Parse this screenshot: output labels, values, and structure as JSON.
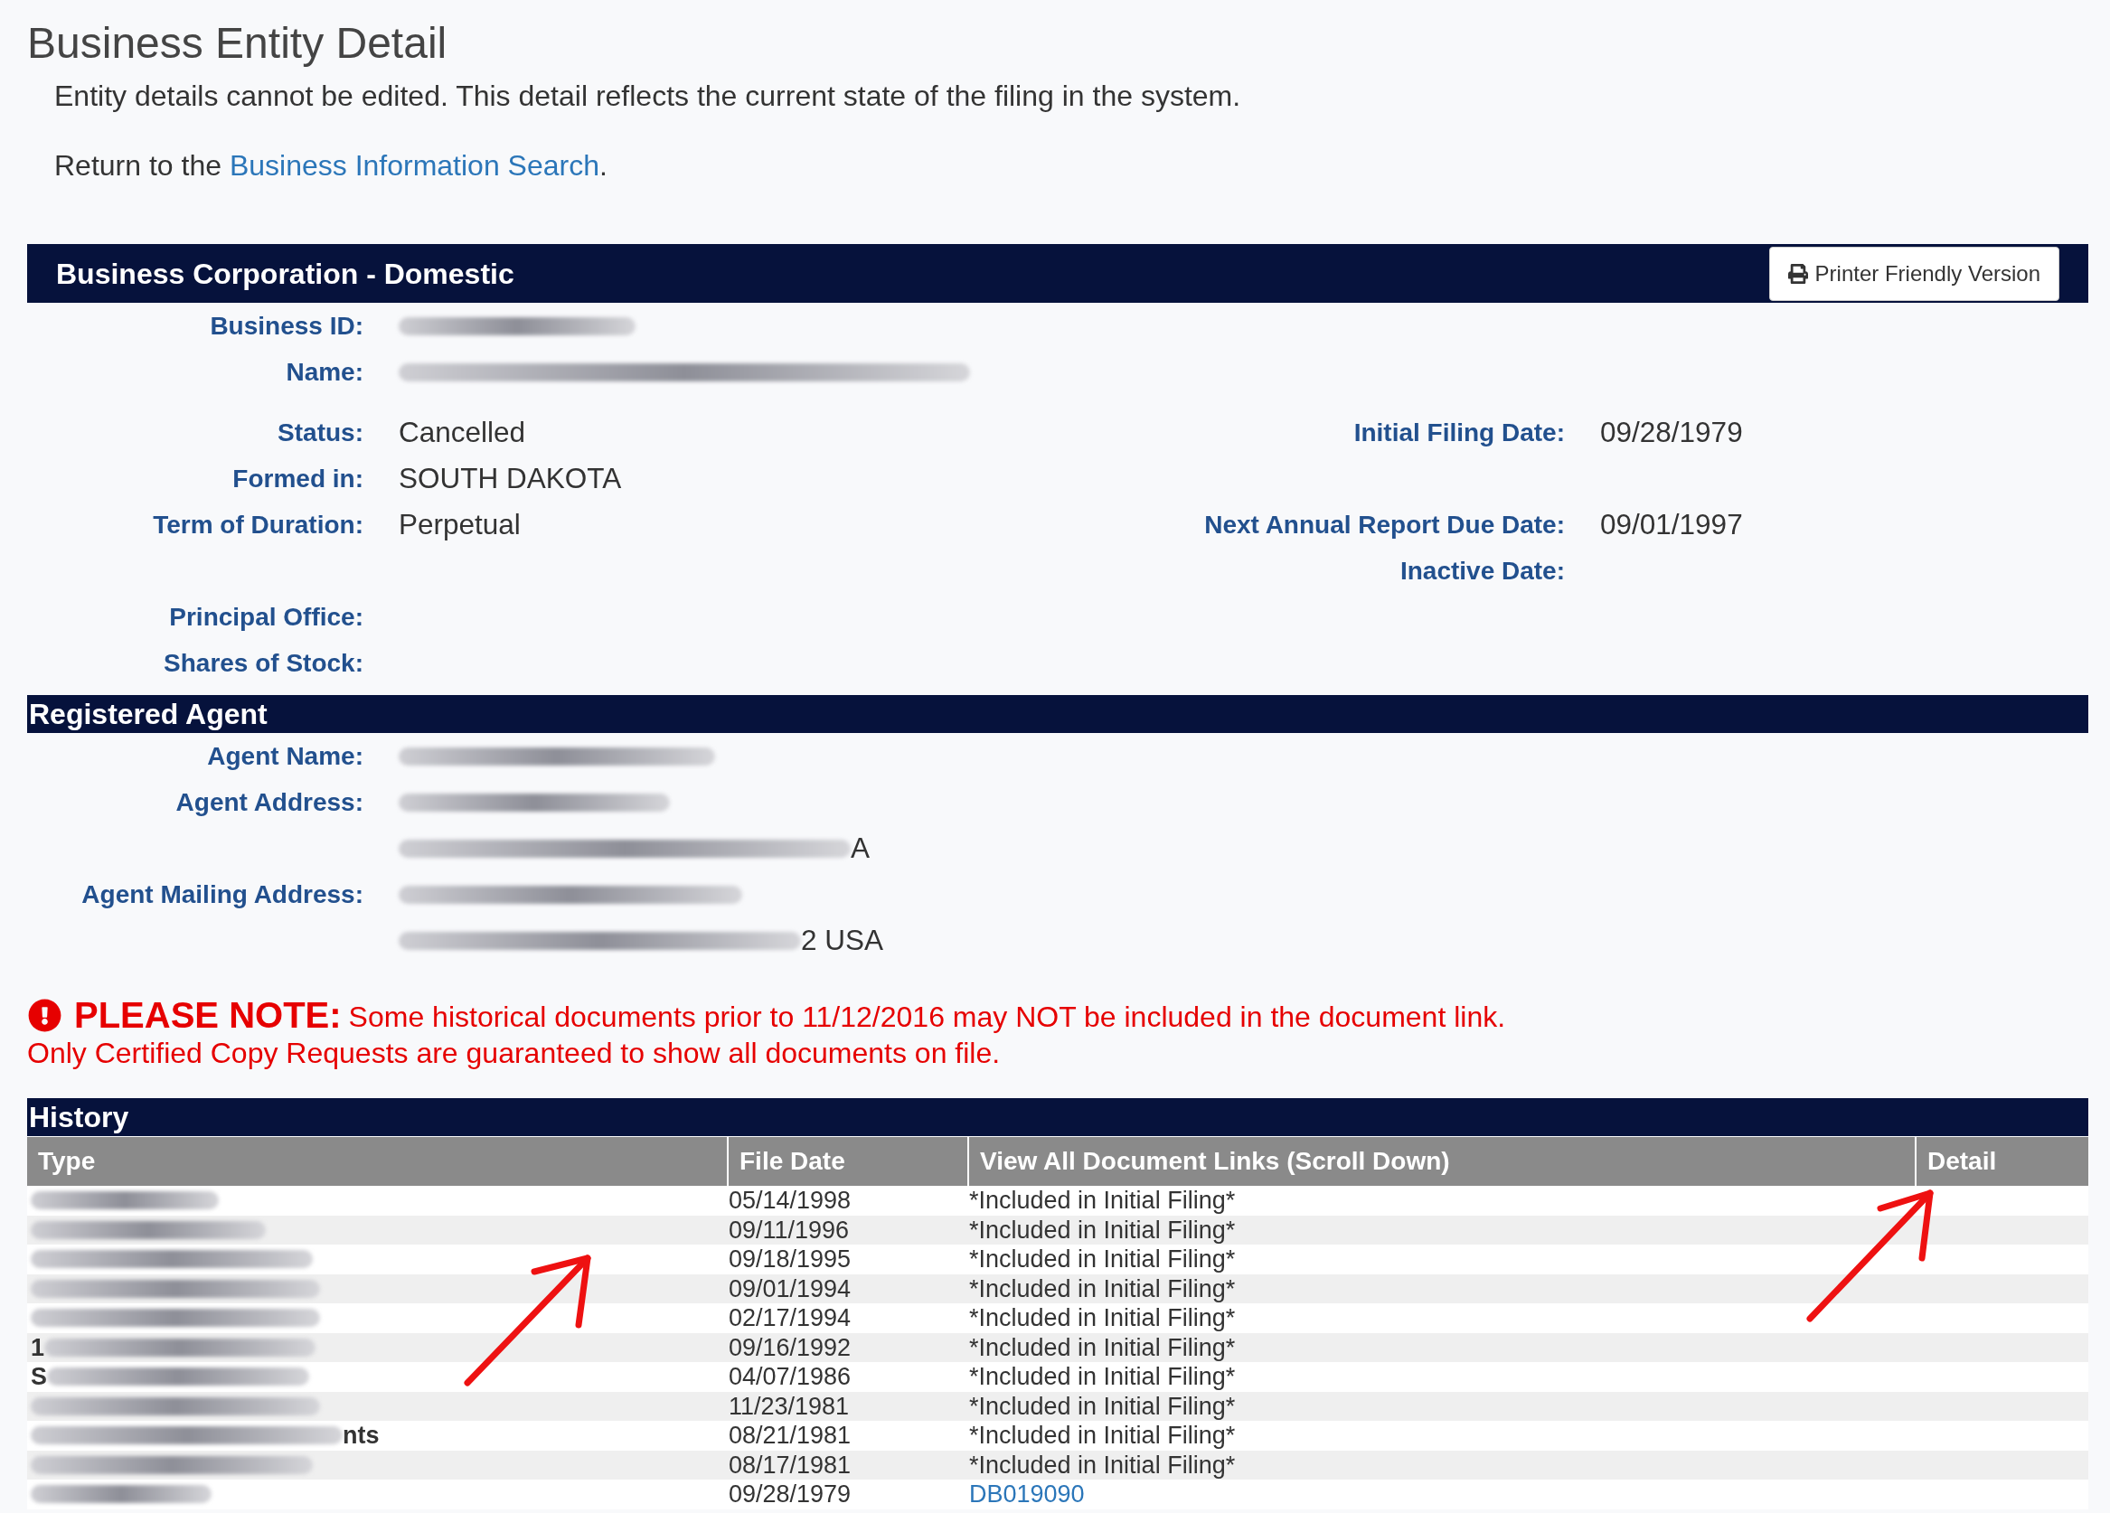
{
  "page_title": "Business Entity Detail",
  "intro": "Entity details cannot be edited. This detail reflects the current state of the filing in the system.",
  "return_line": {
    "before": "Return to the",
    "link": "Business Information Search",
    "after": "."
  },
  "entity": {
    "title": "Business Corporation - Domestic",
    "print_button": {
      "label": "Printer Friendly Version"
    },
    "groups": [
      {
        "rows": [
          {
            "left": {
              "label": "Business ID:",
              "value": {
                "kind": "redacted"
              }
            }
          },
          {
            "left": {
              "label": "Name:",
              "value": {
                "kind": "redacted"
              }
            }
          }
        ]
      },
      {
        "rows": [
          {
            "left": {
              "label": "Status:",
              "value": {
                "kind": "text",
                "text": "Cancelled"
              }
            },
            "right": {
              "label": "Initial Filing Date:",
              "value": {
                "kind": "text",
                "text": "09/28/1979"
              }
            }
          },
          {
            "left": {
              "label": "Formed in:",
              "value": {
                "kind": "text",
                "text": "SOUTH DAKOTA"
              }
            }
          },
          {
            "left": {
              "label": "Term of Duration:",
              "value": {
                "kind": "text",
                "text": "Perpetual"
              }
            },
            "right": {
              "label": "Next Annual Report Due Date:",
              "value": {
                "kind": "text",
                "text": "09/01/1997"
              }
            }
          },
          {
            "right": {
              "label": "Inactive Date:"
            }
          },
          {
            "left": {
              "label": "Principal Office:"
            }
          },
          {
            "left": {
              "label": "Shares of Stock:"
            }
          }
        ]
      }
    ]
  },
  "registered_agent": {
    "title": "Registered Agent",
    "fields": [
      {
        "label": "Agent Name:",
        "lines": [
          {
            "kind": "redacted"
          }
        ]
      },
      {
        "label": "Agent Address:",
        "lines": [
          {
            "kind": "redacted"
          },
          {
            "kind": "redacted",
            "tail": "A"
          }
        ]
      },
      {
        "label": "Agent Mailing Address:",
        "lines": [
          {
            "kind": "redacted"
          },
          {
            "kind": "redacted",
            "tail": "2 USA"
          }
        ]
      }
    ]
  },
  "notice": {
    "label": "PLEASE NOTE:",
    "text": "Some historical documents prior to 11/12/2016 may NOT be included in the document link.",
    "second_line": "Only Certified Copy Requests are guaranteed to show all documents on file."
  },
  "history": {
    "title": "History",
    "columns": [
      "Type",
      "File Date",
      "View All Document Links (Scroll Down)",
      "Detail"
    ],
    "rows": [
      {
        "type": {
          "kind": "redacted"
        },
        "file_date": "05/14/1998",
        "document": {
          "kind": "text",
          "text": "*Included in Initial Filing*"
        }
      },
      {
        "type": {
          "kind": "redacted"
        },
        "file_date": "09/11/1996",
        "document": {
          "kind": "text",
          "text": "*Included in Initial Filing*"
        }
      },
      {
        "type": {
          "kind": "redacted"
        },
        "file_date": "09/18/1995",
        "document": {
          "kind": "text",
          "text": "*Included in Initial Filing*"
        }
      },
      {
        "type": {
          "kind": "redacted"
        },
        "file_date": "09/01/1994",
        "document": {
          "kind": "text",
          "text": "*Included in Initial Filing*"
        }
      },
      {
        "type": {
          "kind": "redacted"
        },
        "file_date": "02/17/1994",
        "document": {
          "kind": "text",
          "text": "*Included in Initial Filing*"
        }
      },
      {
        "type": {
          "kind": "redacted",
          "head": "1"
        },
        "file_date": "09/16/1992",
        "document": {
          "kind": "text",
          "text": "*Included in Initial Filing*"
        }
      },
      {
        "type": {
          "kind": "redacted",
          "head": "S"
        },
        "file_date": "04/07/1986",
        "document": {
          "kind": "text",
          "text": "*Included in Initial Filing*"
        }
      },
      {
        "type": {
          "kind": "redacted"
        },
        "file_date": "11/23/1981",
        "document": {
          "kind": "text",
          "text": "*Included in Initial Filing*"
        }
      },
      {
        "type": {
          "kind": "redacted",
          "tail": "nts"
        },
        "file_date": "08/21/1981",
        "document": {
          "kind": "text",
          "text": "*Included in Initial Filing*"
        }
      },
      {
        "type": {
          "kind": "redacted"
        },
        "file_date": "08/17/1981",
        "document": {
          "kind": "text",
          "text": "*Included in Initial Filing*"
        }
      },
      {
        "type": {
          "kind": "redacted"
        },
        "file_date": "09/28/1979",
        "document": {
          "kind": "link",
          "text": "DB019090"
        }
      }
    ]
  }
}
